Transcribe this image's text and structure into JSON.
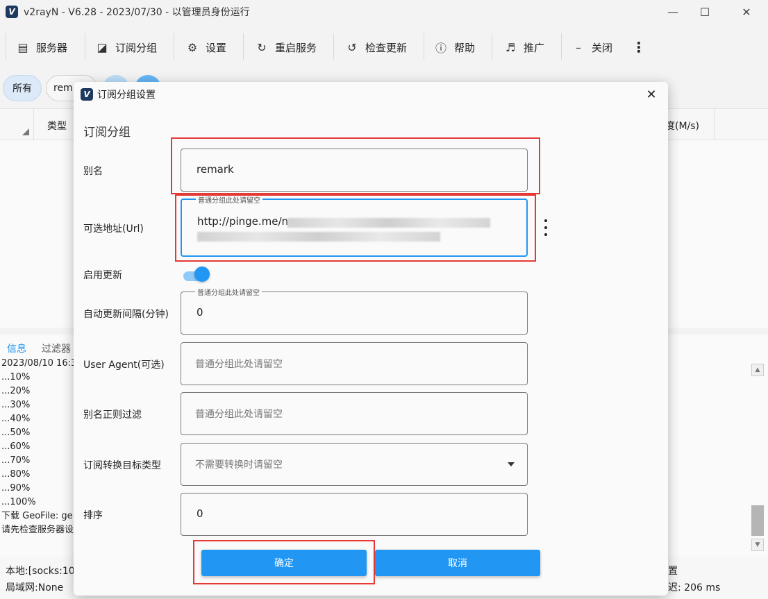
{
  "window": {
    "title": "v2rayN - V6.28 - 2023/07/30 - 以管理员身份运行",
    "logo": "V"
  },
  "toolbar": {
    "items": [
      {
        "label": "服务器",
        "icon": "server-icon"
      },
      {
        "label": "订阅分组",
        "icon": "subscription-icon"
      },
      {
        "label": "设置",
        "icon": "gear-icon"
      },
      {
        "label": "重启服务",
        "icon": "restart-icon"
      },
      {
        "label": "检查更新",
        "icon": "update-icon"
      },
      {
        "label": "帮助",
        "icon": "help-icon"
      },
      {
        "label": "推广",
        "icon": "speaker-icon"
      },
      {
        "label": "关闭",
        "icon": "minus-icon"
      }
    ]
  },
  "chips": {
    "all": "所有",
    "remark": "rem"
  },
  "grid": {
    "col_type": "类型",
    "col_speed": "度(M/s)"
  },
  "log": {
    "tab_info": "信息",
    "tab_filter": "过滤器",
    "lines": [
      "2023/08/10 16:3",
      "...10%",
      "...20%",
      "...30%",
      "...40%",
      "...50%",
      "...60%",
      "...70%",
      "...80%",
      "...90%",
      "...100%",
      "下载 GeoFile: ge",
      "请先检查服务器设"
    ]
  },
  "status": {
    "local": "本地:[socks:10",
    "lan": "局域网:None",
    "right_top": "置",
    "latency": "迟: 206 ms"
  },
  "dialog": {
    "title": "订阅分组设置",
    "section": "订阅分组",
    "fields": {
      "alias": {
        "label": "别名",
        "value": "remark"
      },
      "url": {
        "label": "可选地址(Url)",
        "float_label": "普通分组此处请留空",
        "value": "http://pinge.me/n"
      },
      "enable_update": {
        "label": "启用更新",
        "checked": true
      },
      "interval": {
        "label": "自动更新间隔(分钟)",
        "float_label": "普通分组此处请留空",
        "value": "0"
      },
      "user_agent": {
        "label": "User Agent(可选)",
        "placeholder": "普通分组此处请留空"
      },
      "filter": {
        "label": "别名正则过滤",
        "placeholder": "普通分组此处请留空"
      },
      "convert": {
        "label": "订阅转换目标类型",
        "placeholder": "不需要转换时请留空"
      },
      "sort": {
        "label": "排序",
        "value": "0"
      }
    },
    "ok": "确定",
    "cancel": "取消"
  },
  "colors": {
    "accent": "#2196f3",
    "highlight": "#e53935"
  }
}
